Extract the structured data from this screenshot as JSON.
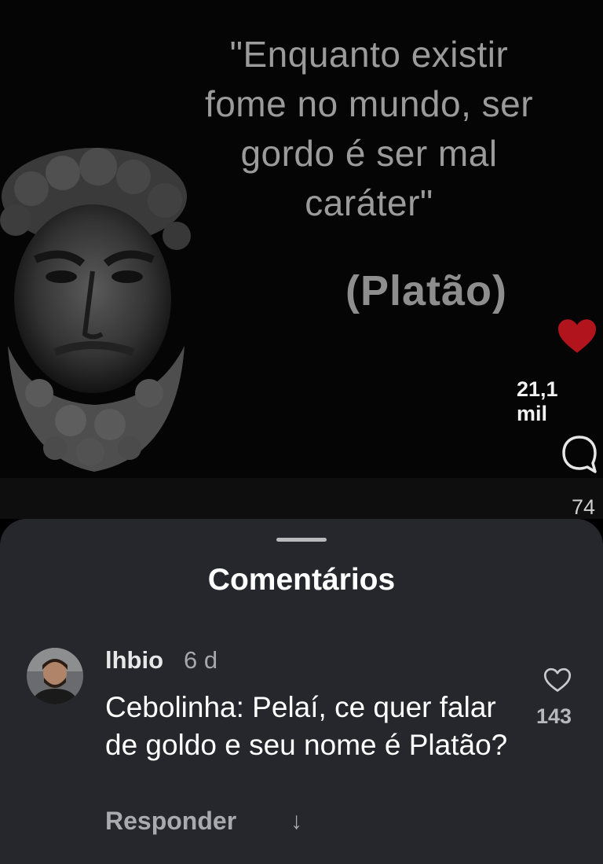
{
  "post": {
    "quote_text": "\"Enquanto existir\nfome no mundo, ser\ngordo é ser mal\ncaráter\"",
    "author_text": "(Platão)",
    "likes": "21,1 mil",
    "comments": "74",
    "like_color": "#b1141c"
  },
  "sheet": {
    "title": "Comentários"
  },
  "comment": {
    "username": "lhbio",
    "time": "6 d",
    "text": "Cebolinha: Pelaí, ce quer falar de goldo e seu nome é Platão?",
    "reply_label": "Responder",
    "expand_icon": "↓",
    "like_count": "143"
  }
}
